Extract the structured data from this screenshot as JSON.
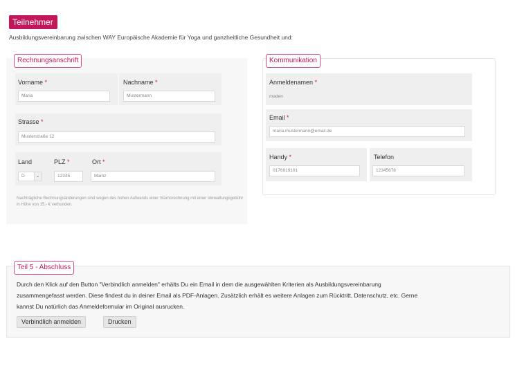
{
  "header": {
    "badge": "Teilnehmer",
    "intro": "Ausbildungsvereinbarung zwischen WAY Europäische Akademie für Yoga und ganzheitliche Gesundheit und:"
  },
  "billing": {
    "legend": "Rechnungsanschrift",
    "vorname_label": "Vorname",
    "vorname_value": "Maria",
    "nachname_label": "Nachname",
    "nachname_value": "Mustermann",
    "strasse_label": "Strasse",
    "strasse_value": "Musterstraße 12",
    "land_label": "Land",
    "land_value": "D",
    "plz_label": "PLZ",
    "plz_value": "12345",
    "ort_label": "Ort",
    "ort_value": "Mainz",
    "required_mark": "*",
    "note": "Nachträgliche Rechnungsänderungen sind wegen des hohen Aufwands einer Stornorechnung mit einer Verwaltungsgebühr in Höhe von 15,- € verbunden."
  },
  "communication": {
    "legend": "Kommunikation",
    "username_label": "Anmeldenamen",
    "username_value": "maden",
    "email_label": "Email",
    "email_value": "maria.mustermann@email.de",
    "handy_label": "Handy",
    "handy_value": "0176919101",
    "telefon_label": "Telefon",
    "telefon_value": "12345678"
  },
  "section5": {
    "legend": "Teil 5 - Abschluss",
    "line1": "Durch den Klick auf den Button \"Verbindlich anmelden\" erhälts Du ein Email in dem die ausgewählten Kriterien als Ausbildungsvereinbarung",
    "line2": "zusammengefasst werden. Diese findest du in deiner Email als PDF-Anlagen. Zusätzlich erhält es weitere Anlagen zum Rücktritt, Datenschutz, etc. Gerne",
    "line3": "kannst Du natürlich das Anmeldeformular im Original ausrucken.",
    "submit_label": "Verbindlich anmelden",
    "print_label": "Drucken"
  },
  "colors": {
    "accent": "#c2185b",
    "panel_bg": "#f7f7f7"
  }
}
